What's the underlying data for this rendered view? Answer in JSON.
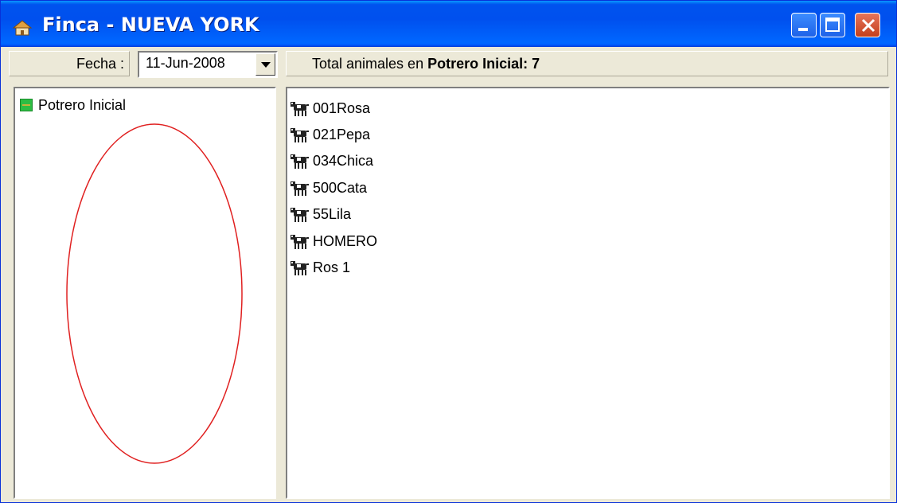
{
  "window": {
    "title": "Finca - NUEVA YORK",
    "app_icon": "house-icon",
    "controls": [
      "minimize-icon",
      "maximize-icon",
      "close-icon"
    ]
  },
  "toolbar": {
    "date_label": "Fecha :",
    "date_value": "11-Jun-2008",
    "total_prefix": "Total animales en ",
    "total_value": "Potrero Inicial: 7"
  },
  "tree": {
    "items": [
      {
        "label": "Potrero Inicial",
        "icon": "paddock-icon"
      }
    ]
  },
  "animals": {
    "icon": "cow-icon",
    "items": [
      "001Rosa",
      "021Pepa",
      "034Chica",
      "500Cata",
      "55Lila",
      "HOMERO",
      "Ros 1"
    ]
  },
  "colors": {
    "titlebar": "#0054e3",
    "window_bg": "#ece9d8",
    "annotation": "#e02020",
    "paddock_icon": "#2dbd44"
  }
}
